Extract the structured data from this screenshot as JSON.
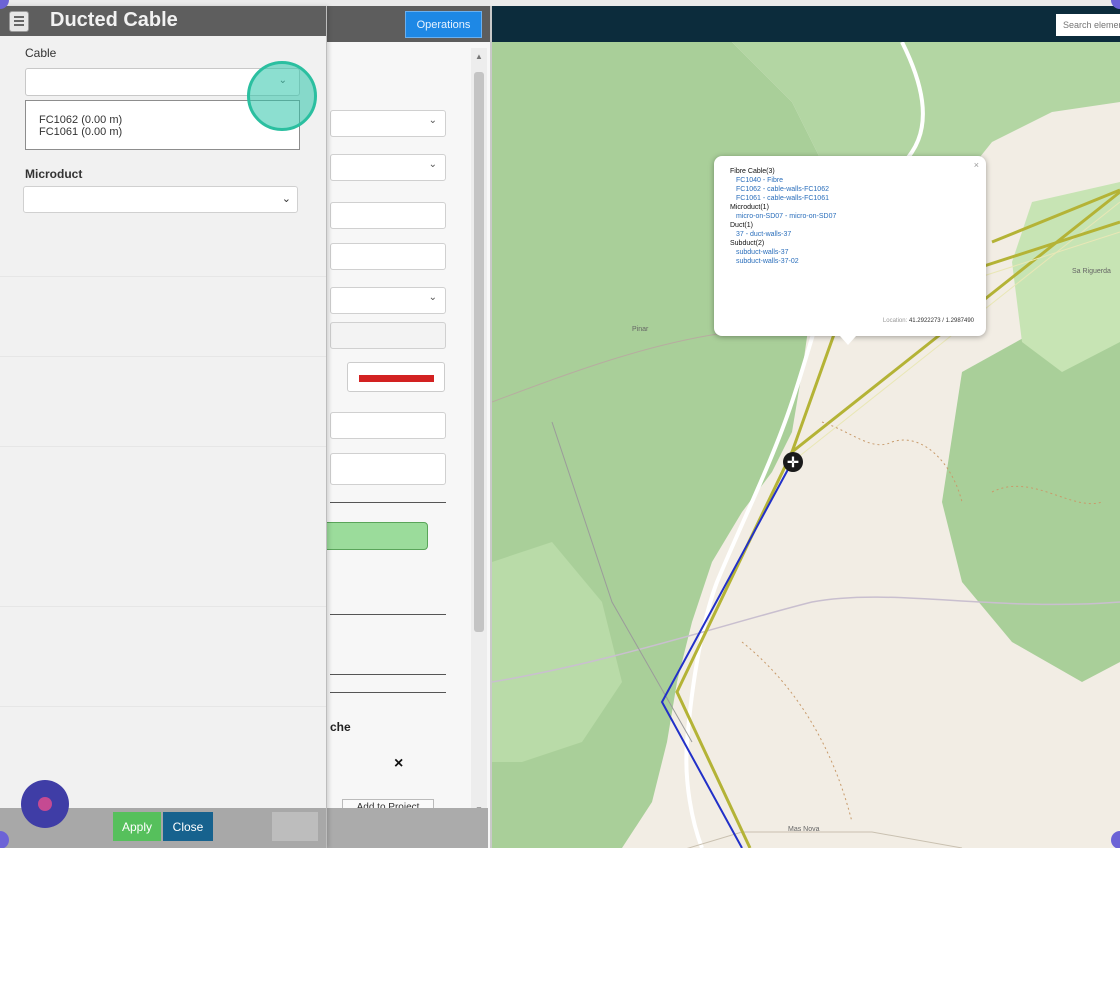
{
  "operations_button": "Operations",
  "form_panel": {
    "column_header_partial": "che",
    "remove_glyph": "×",
    "add_to_project_label": "Add to Project"
  },
  "map": {
    "search_placeholder": "Search elements",
    "place_labels": [
      "Pinar",
      "Sa Riguerda",
      "Mas Nova"
    ],
    "colors": {
      "duct": "#b4b336",
      "route": "#2230c8",
      "forest": "#a9cf99",
      "ground": "#f2ede4"
    },
    "popup": {
      "close_glyph": "×",
      "sections": [
        {
          "heading": "Fibre Cable(3)",
          "items": [
            "FC1040 - Fibre",
            "FC1062 - cable-walls-FC1062",
            "FC1061 - cable-walls-FC1061"
          ]
        },
        {
          "heading": "Microduct(1)",
          "items": [
            "micro-on-SD07 - micro-on-SD07"
          ]
        },
        {
          "heading": "Duct(1)",
          "items": [
            "37 - duct-walls-37"
          ]
        },
        {
          "heading": "Subduct(2)",
          "items": [
            "subduct-walls-37",
            "subduct-walls-37-02"
          ]
        }
      ],
      "location_label": "Location:",
      "location_value": "41.2922273 / 1.2987490"
    },
    "marker_icon": "location-crosshair-icon"
  },
  "dialog": {
    "title": "Ducted Cable",
    "title_icon": "document-list-icon",
    "cable_label": "Cable",
    "cable_options": [
      "FC1062 (0.00 m)",
      "FC1061 (0.00 m)"
    ],
    "microduct_label": "Microduct",
    "apply_label": "Apply",
    "close_label": "Close",
    "chevron_glyph": "⌄"
  }
}
